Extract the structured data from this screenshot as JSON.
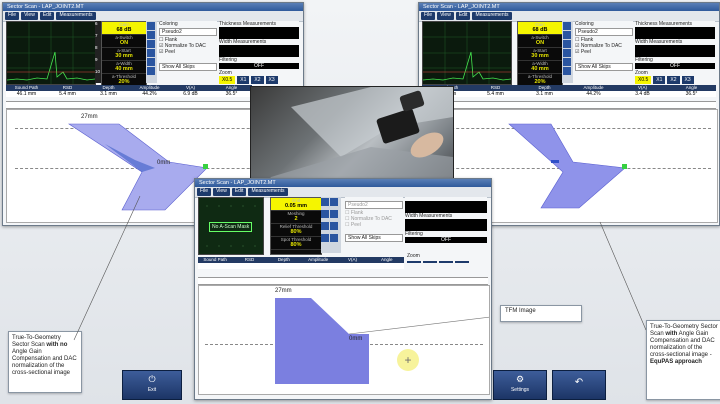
{
  "left_window": {
    "title": "Sector Scan - LAP_JOINT2.MT",
    "menu": [
      "File",
      "View",
      "Edit",
      "Measurements"
    ],
    "params": [
      {
        "label": "Gain",
        "value": "68 dB"
      },
      {
        "label": "a-Switch",
        "value": "ON"
      },
      {
        "label": "a-Start",
        "value": "30 mm"
      },
      {
        "label": "a-Width",
        "value": "40 mm"
      },
      {
        "label": "a-Threshold",
        "value": "20%"
      }
    ],
    "param_numbers": [
      "6",
      "7",
      "8",
      "9",
      "10"
    ],
    "coloring_label": "Coloring",
    "coloring_value": "Pseudo2",
    "checkboxes": [
      "Flank",
      "Normalize To DAC",
      "Peel"
    ],
    "skips_value": "Show All Skips",
    "thickness_label": "Thickness Measurements",
    "width_label": "Width Measurements",
    "filtering_label": "Filtering",
    "filtering_value": "OFF",
    "zoom_label": "Zoom",
    "zoom_buttons": [
      "X0.5",
      "X1",
      "X2",
      "X3"
    ],
    "meas_headers": [
      "Sound Path",
      "RSD",
      "Depth",
      "Amplitude",
      "V(A)",
      "Angle"
    ],
    "meas_values": [
      "46.1 mm",
      "5.4 mm",
      "3.1 mm",
      "44.2%",
      "6.9 dB",
      "36.5°"
    ],
    "label_27": "27mm",
    "label_0": "0mm"
  },
  "right_window": {
    "title": "Sector Scan - LAP_JOINT2.MT",
    "menu": [
      "File",
      "View",
      "Edit",
      "Measurements"
    ],
    "params": [
      {
        "label": "Gain",
        "value": "68 dB"
      },
      {
        "label": "a-Switch",
        "value": "ON"
      },
      {
        "label": "a-Start",
        "value": "30 mm"
      },
      {
        "label": "a-Width",
        "value": "40 mm"
      },
      {
        "label": "a-Threshold",
        "value": "20%"
      }
    ],
    "coloring_label": "Coloring",
    "coloring_value": "Pseudo2",
    "checkboxes": [
      "Flank",
      "Normalize To DAC",
      "Peel"
    ],
    "skips_value": "Show All Skips",
    "thickness_label": "Thickness Measurements",
    "width_label": "Width Measurements",
    "filtering_label": "Filtering",
    "filtering_value": "OFF",
    "zoom_label": "Zoom",
    "zoom_buttons": [
      "X0.5",
      "X1",
      "X2",
      "X3"
    ],
    "meas_headers": [
      "Sound Path",
      "RSD",
      "Depth",
      "Amplitude",
      "V(A)",
      "Angle"
    ],
    "meas_values": [
      "46.1 mm",
      "5.4 mm",
      "3.1 mm",
      "44.2%",
      "3.4 dB",
      "36.5°"
    ]
  },
  "center_window": {
    "title": "Sector Scan - LAP_JOINT2.MT",
    "menu": [
      "File",
      "View",
      "Edit",
      "Measurements"
    ],
    "params": [
      {
        "label": "Grid",
        "value": "0.05 mm"
      },
      {
        "label": "Meshing",
        "value": "2"
      },
      {
        "label": "Relief Threshold",
        "value": "80%"
      },
      {
        "label": "Spot Threshold",
        "value": "80%"
      }
    ],
    "ascan_label": "No A-Scan Mask",
    "coloring_value": "Pseudo2",
    "checkboxes": [
      "Flank",
      "Normalize To DAC",
      "Peel"
    ],
    "skips_value": "Show All Skips",
    "width_label": "Width Measurements",
    "filtering_label": "Filtering",
    "filtering_value": "OFF",
    "zoom_label": "Zoom",
    "meas_headers": [
      "Sound Path",
      "RSD",
      "Depth",
      "Amplitude",
      "V(A)",
      "Angle"
    ],
    "label_27": "27mm",
    "label_0": "0mm",
    "tfm_label": "TFM Image"
  },
  "callouts": {
    "left_pre": "True-To-Geometry Sector Scan ",
    "left_bold": "with no",
    "left_post": " Angle Gain Compensation and DAC normalization of the cross-sectional image",
    "right_pre": "True-To-Geometry Sector Scan ",
    "right_bold1": "with",
    "right_mid": " Angle Gain Compensation and DAC normalization of the cross-sectional image - ",
    "right_bold2": "EquPAS approach"
  },
  "taskbar": {
    "left_button": "Exit",
    "right_button": "Settings"
  },
  "colors": {
    "title_blue": "#2f5a9b",
    "scan_fill": "#7b7fe0",
    "highlight_yellow": "#f5f500",
    "menu_navy": "#1d3a6b"
  }
}
